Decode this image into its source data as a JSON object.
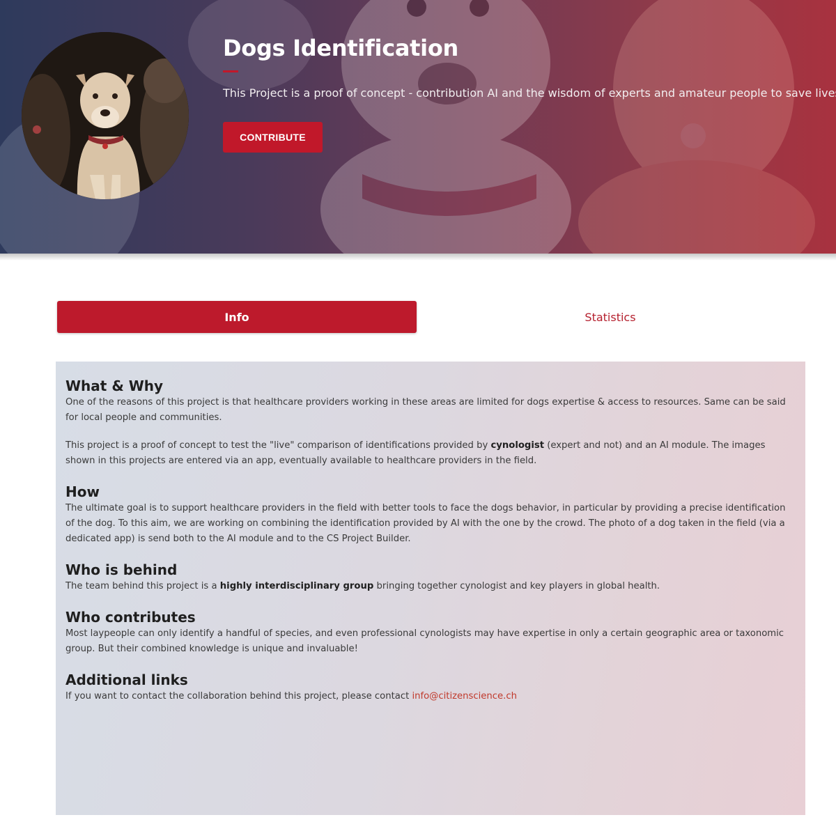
{
  "hero": {
    "title": "Dogs Identification",
    "description": "This Project is a proof of concept - contribution AI and the wisdom of experts and amateur people to save lives.",
    "contribute_label": "CONTRIBUTE",
    "avatar_alt": "dog-photo"
  },
  "tabs": [
    {
      "label": "Info",
      "active": true
    },
    {
      "label": "Statistics",
      "active": false
    }
  ],
  "content": {
    "what_why": {
      "title": "What & Why",
      "p1": "One of the reasons of this project is that healthcare providers working in these areas are limited for dogs expertise & access to resources. Same can be said for local people and communities.",
      "p2_a": "This project is a proof of concept to test the \"live\" comparison of identifications provided by ",
      "p2_bold": "cynologist",
      "p2_b": " (expert and not) and an AI module. The images shown in this projects are entered via an app, eventually available to healthcare providers in the field."
    },
    "how": {
      "title": "How",
      "p1": "The ultimate goal is to support healthcare providers in the field with better tools to face the dogs behavior, in particular by providing a precise identification of the dog. To this aim, we are working on combining the identification provided by AI with the one by the crowd. The photo of a dog taken in the field (via a dedicated app) is send both to the AI module and to the CS Project Builder."
    },
    "who_behind": {
      "title": "Who is behind",
      "p_a": "The team behind this project is a ",
      "p_bold": "highly interdisciplinary group",
      "p_b": " bringing together cynologist and key players in global health."
    },
    "who_contributes": {
      "title": "Who contributes",
      "p1": "Most laypeople can only identify a handful of species, and even professional cynologists may have expertise in only a certain geographic area or taxonomic group. But their combined knowledge is unique and invaluable!"
    },
    "links": {
      "title": "Additional links",
      "p_a": "If you want to contact the collaboration behind this project, please contact ",
      "email": "info@citizenscience.ch"
    }
  },
  "colors": {
    "accent": "#c1182a",
    "link": "#c0392b"
  }
}
